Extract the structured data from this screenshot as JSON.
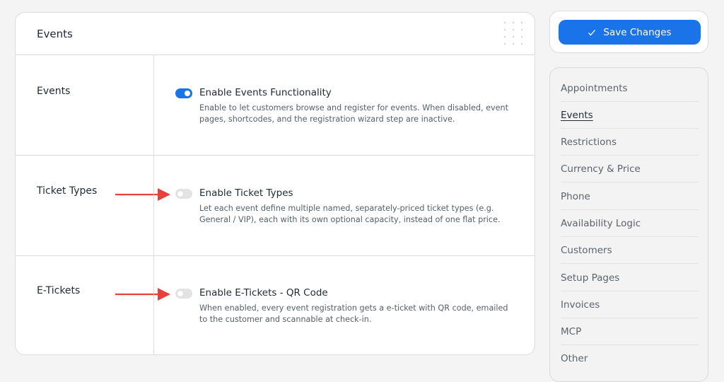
{
  "card": {
    "title": "Events",
    "rows": [
      {
        "label": "Events",
        "toggle_on": true,
        "option_title": "Enable Events Functionality",
        "option_desc": "Enable to let customers browse and register for events. When disabled, event pages, shortcodes, and the registration wizard step are inactive."
      },
      {
        "label": "Ticket Types",
        "toggle_on": false,
        "option_title": "Enable Ticket Types",
        "option_desc": "Let each event define multiple named, separately-priced ticket types (e.g. General / VIP), each with its own optional capacity, instead of one flat price."
      },
      {
        "label": "E-Tickets",
        "toggle_on": false,
        "option_title": "Enable E-Tickets - QR Code",
        "option_desc": "When enabled, every event registration gets a e-ticket with QR code, emailed to the customer and scannable at check-in."
      }
    ]
  },
  "save": {
    "label": "Save Changes",
    "icon": "check-icon"
  },
  "nav": {
    "items": [
      {
        "label": "Appointments",
        "active": false
      },
      {
        "label": "Events",
        "active": true
      },
      {
        "label": "Restrictions",
        "active": false
      },
      {
        "label": "Currency & Price",
        "active": false
      },
      {
        "label": "Phone",
        "active": false
      },
      {
        "label": "Availability Logic",
        "active": false
      },
      {
        "label": "Customers",
        "active": false
      },
      {
        "label": "Setup Pages",
        "active": false
      },
      {
        "label": "Invoices",
        "active": false
      },
      {
        "label": "MCP",
        "active": false
      },
      {
        "label": "Other",
        "active": false
      }
    ]
  },
  "colors": {
    "accent": "#1a73e8",
    "annotation_arrow": "#e8413b",
    "background": "#f4f4f4"
  }
}
